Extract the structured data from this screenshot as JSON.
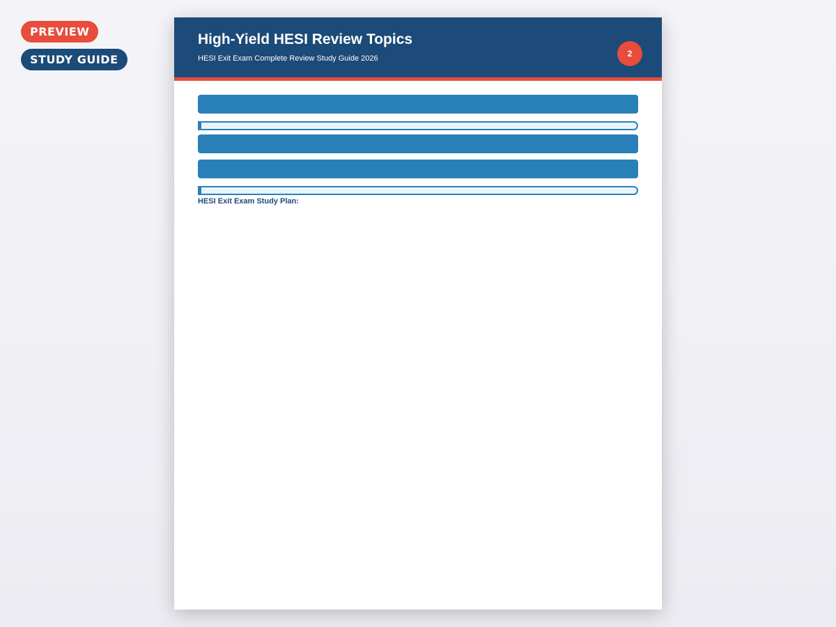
{
  "badges": {
    "preview": "PREVIEW",
    "study_guide": "STUDY GUIDE"
  },
  "page": {
    "title": "High-Yield HESI Review Topics",
    "subtitle": "HESI Exit Exam Complete Review Study Guide 2026",
    "page_number": "2",
    "study_plan_heading": "HESI Exit Exam Study Plan:"
  },
  "colors": {
    "header": "#1c4a79",
    "accent": "#e74c3c",
    "section_bar": "#2980b9",
    "highlight_fill": "#eaf4fb"
  }
}
